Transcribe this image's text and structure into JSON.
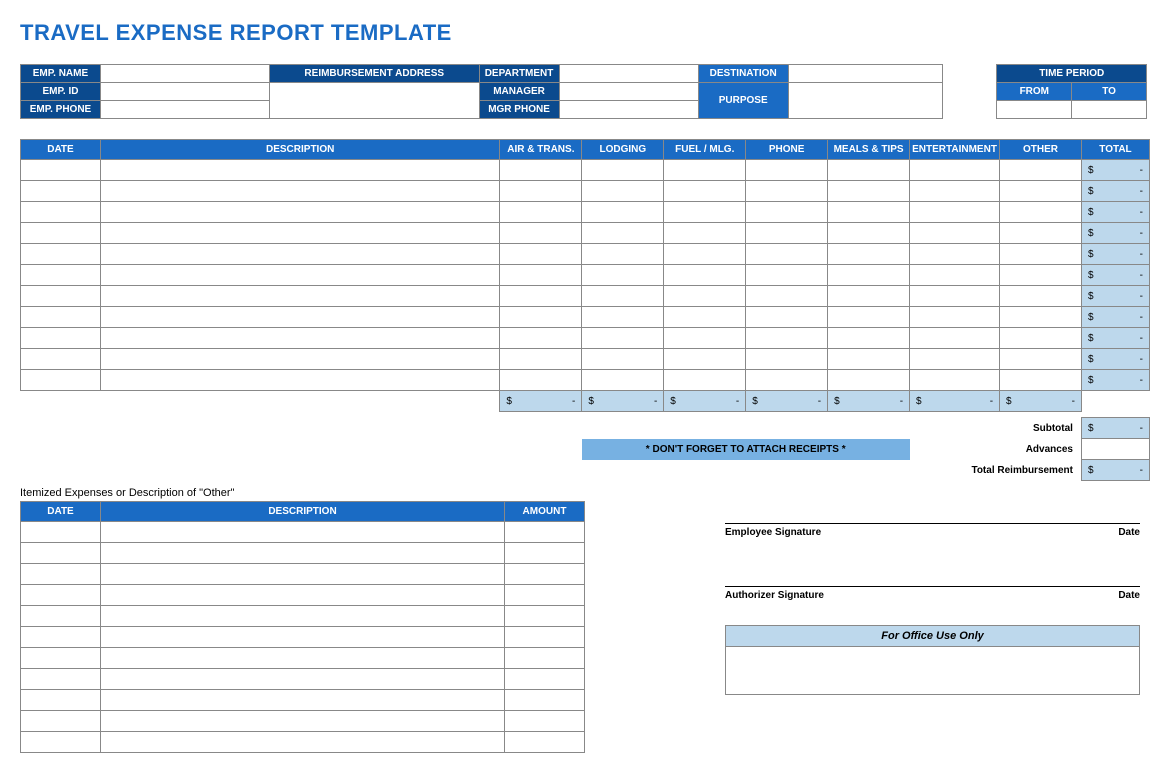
{
  "title": "TRAVEL EXPENSE REPORT TEMPLATE",
  "info": {
    "emp_name_label": "EMP. NAME",
    "emp_id_label": "EMP. ID",
    "emp_phone_label": "EMP. PHONE",
    "reimb_addr_label": "REIMBURSEMENT ADDRESS",
    "department_label": "DEPARTMENT",
    "manager_label": "MANAGER",
    "mgr_phone_label": "MGR PHONE",
    "destination_label": "DESTINATION",
    "purpose_label": "PURPOSE",
    "time_period_label": "TIME PERIOD",
    "from_label": "FROM",
    "to_label": "TO"
  },
  "main_headers": {
    "date": "DATE",
    "description": "DESCRIPTION",
    "air_trans": "AIR & TRANS.",
    "lodging": "LODGING",
    "fuel_mlg": "FUEL / MLG.",
    "phone": "PHONE",
    "meals_tips": "MEALS & TIPS",
    "entertainment": "ENTERTAINMENT",
    "other": "OTHER",
    "total": "TOTAL"
  },
  "currency": "$",
  "dash": "-",
  "labels": {
    "subtotal": "Subtotal",
    "advances": "Advances",
    "total_reimbursement": "Total Reimbursement",
    "receipts": "* DON'T FORGET TO ATTACH RECEIPTS *",
    "itemized_title": "Itemized Expenses or Description of \"Other\"",
    "emp_sig": "Employee Signature",
    "auth_sig": "Authorizer Signature",
    "sig_date": "Date",
    "office": "For Office Use Only"
  },
  "itemized_headers": {
    "date": "DATE",
    "description": "DESCRIPTION",
    "amount": "AMOUNT"
  }
}
